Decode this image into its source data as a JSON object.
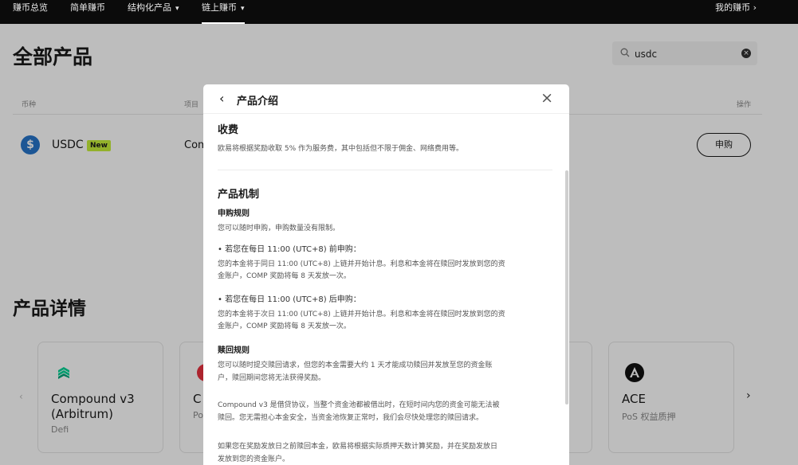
{
  "nav": {
    "items": [
      {
        "label": "赚币总览",
        "has_dropdown": false,
        "active": false
      },
      {
        "label": "简单赚币",
        "has_dropdown": false,
        "active": false
      },
      {
        "label": "结构化产品",
        "has_dropdown": true,
        "active": false
      },
      {
        "label": "链上赚币",
        "has_dropdown": true,
        "active": true
      }
    ],
    "right_label": "我的赚币 ›"
  },
  "page": {
    "title": "全部产品",
    "search": {
      "value": "usdc",
      "clear_icon": "clear-circle-icon"
    },
    "columns": [
      "币种",
      "项目",
      "操作"
    ],
    "row": {
      "coin": "USDC",
      "badge": "New",
      "project": "Com",
      "action": "申购"
    },
    "details_title": "产品详情",
    "cards": [
      {
        "title": "Compound v3 (Arbitrum)",
        "subtitle": "Defi",
        "icon": "compound-icon"
      },
      {
        "title": "C",
        "subtitle": "Po",
        "icon": "red-circle-icon"
      },
      {
        "title": "ACE",
        "subtitle": "PoS 权益质押",
        "icon": "ace-icon"
      }
    ]
  },
  "modal": {
    "title": "产品介绍",
    "fee": {
      "heading": "收费",
      "text": "欧易将根据奖励收取 5% 作为服务费，其中包括但不限于佣金、网络费用等。"
    },
    "mechanism": {
      "heading": "产品机制",
      "subscribe_rules": {
        "heading": "申购规则",
        "intro": "您可以随时申购，申购数量没有限制。",
        "before": {
          "bullet": "若您在每日 11:00 (UTC+8) 前申购：",
          "line1": "您的本金将于同日 11:00 (UTC+8) 上链并开始计息。利息和本金将在赎回时发放到您的资",
          "line2": "金账户，COMP 奖励将每 8 天发放一次。"
        },
        "after": {
          "bullet": "若您在每日 11:00 (UTC+8) 后申购：",
          "line1": "您的本金将于次日 11:00 (UTC+8) 上链并开始计息。利息和本金将在赎回时发放到您的资",
          "line2": "金账户，COMP 奖励将每 8 天发放一次。"
        }
      },
      "redeem_rules": {
        "heading": "赎回规则",
        "p1_line1": "您可以随时提交赎回请求，但您的本金需要大约 1 天才能成功赎回并发放至您的资金账",
        "p1_line2": "户，赎回期间您将无法获得奖励。",
        "p2_line1": "Compound v3 是借贷协议，当整个资金池都被借出时，在短时间内您的资金可能无法被",
        "p2_line2": "赎回。您无需担心本金安全，当资金池恢复正常时，我们会尽快处理您的赎回请求。",
        "p3_line1": "如果您在奖励发放日之前赎回本金，欧易将根据实际质押天数计算奖励，并在奖励发放日",
        "p3_line2": "发放到您的资金账户。"
      }
    }
  }
}
